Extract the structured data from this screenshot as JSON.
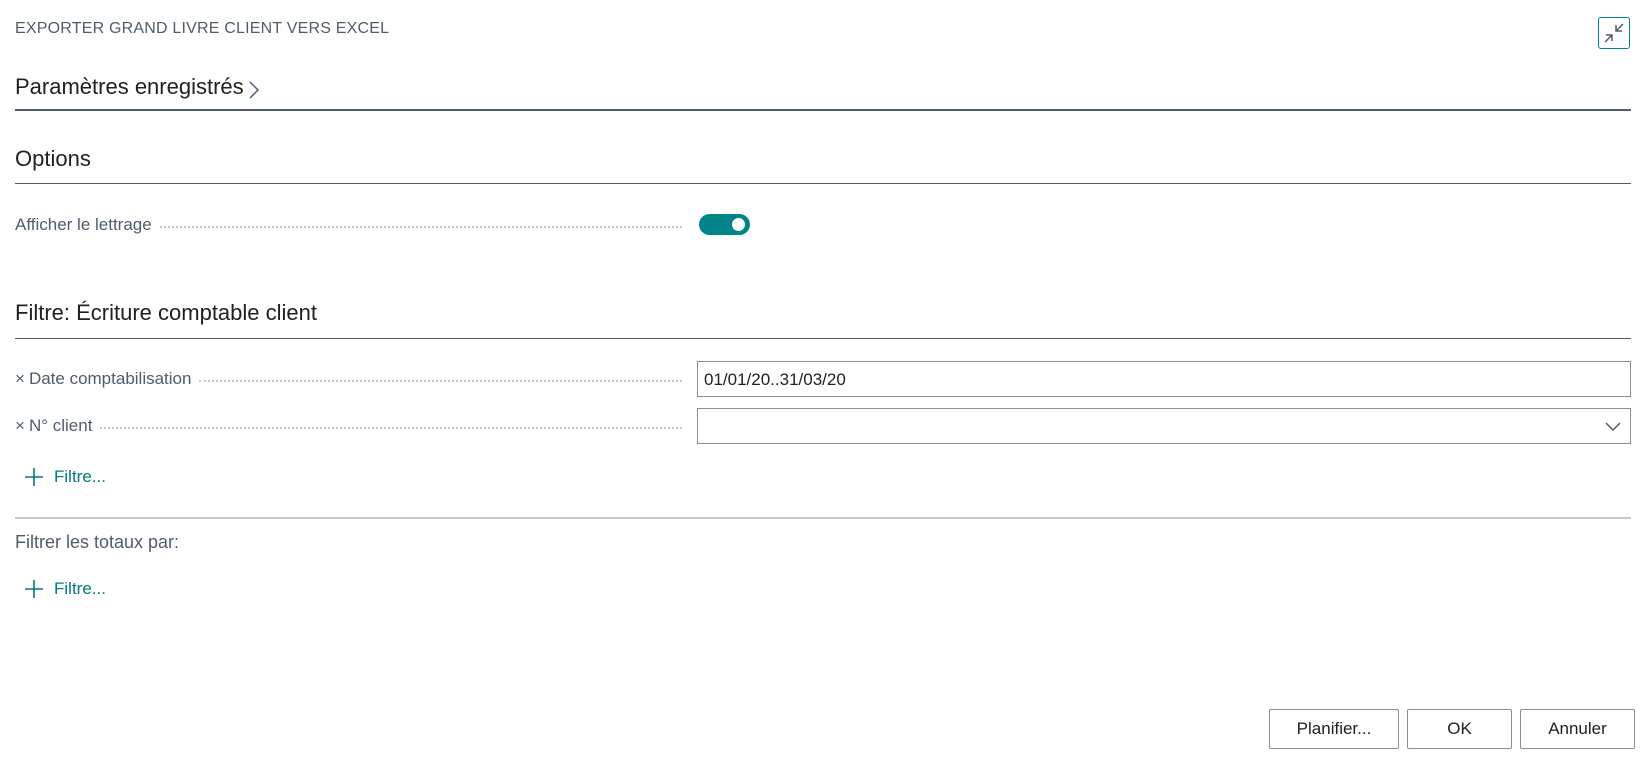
{
  "dialog": {
    "title": "EXPORTER GRAND LIVRE CLIENT VERS EXCEL"
  },
  "icons": {
    "collapse": "collapse-arrows-icon",
    "chevron_right": "chevron-right-icon",
    "chevron_down": "chevron-down-icon",
    "remove": "close-icon",
    "add": "plus-icon"
  },
  "colors": {
    "accent": "#008489",
    "link": "#00787d",
    "label": "#505c6d"
  },
  "saved_settings": {
    "label": "Paramètres enregistrés"
  },
  "options": {
    "heading": "Options",
    "show_lettering": {
      "label": "Afficher le lettrage",
      "value": true
    }
  },
  "filter": {
    "heading": "Filtre: Écriture comptable client",
    "fields": [
      {
        "remove_glyph": "×",
        "label": "Date comptabilisation",
        "value": "01/01/20..31/03/20"
      },
      {
        "remove_glyph": "×",
        "label": "N° client",
        "value": ""
      }
    ],
    "add_filter_label": "Filtre..."
  },
  "totals": {
    "label": "Filtrer les totaux par:",
    "add_filter_label": "Filtre..."
  },
  "actions": {
    "schedule": "Planifier...",
    "ok": "OK",
    "cancel": "Annuler"
  }
}
